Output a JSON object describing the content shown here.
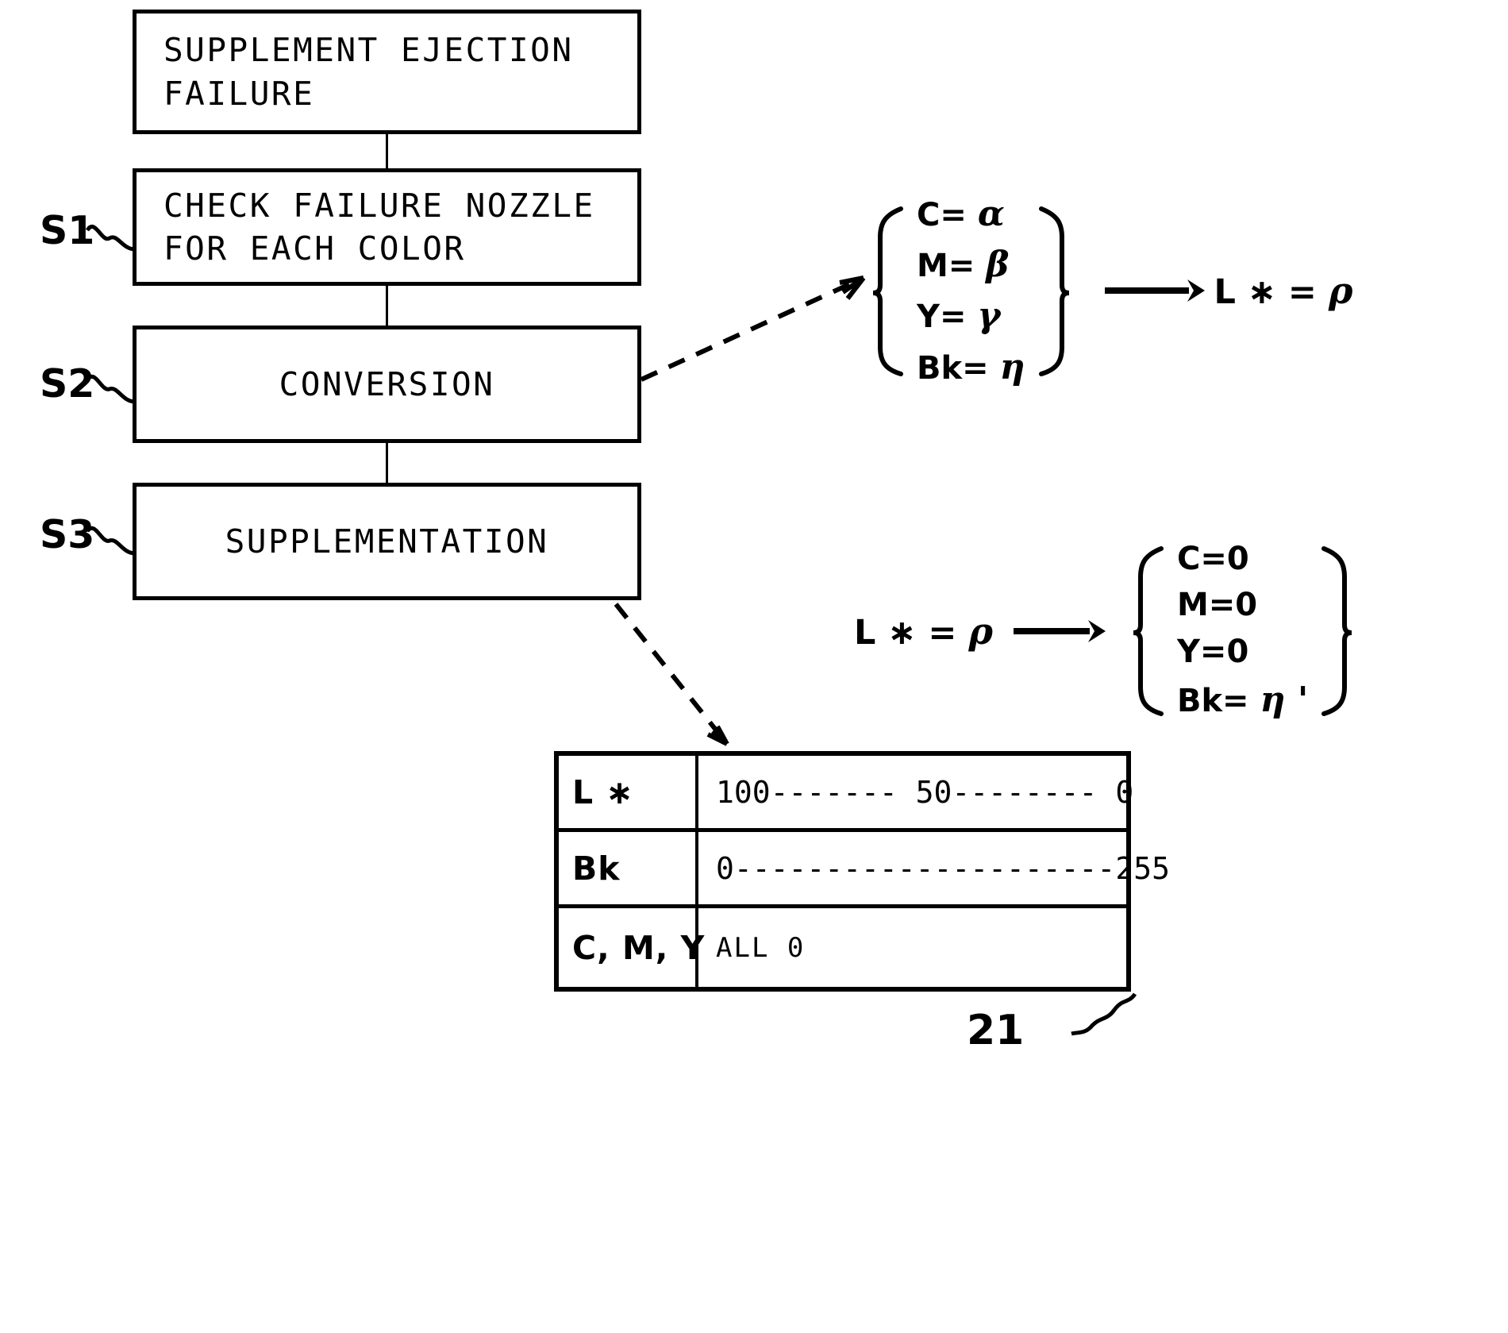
{
  "figure": {
    "reference_number": "21"
  },
  "flow": {
    "boxes": [
      {
        "id": "box-header",
        "text": "SUPPLEMENT EJECTION\nFAILURE",
        "align": "left"
      },
      {
        "id": "box-s1",
        "text": "CHECK FAILURE NOZZLE\nFOR EACH COLOR",
        "align": "left"
      },
      {
        "id": "box-s2",
        "text": "CONVERSION",
        "align": "center"
      },
      {
        "id": "box-s3",
        "text": "SUPPLEMENTATION",
        "align": "center"
      }
    ],
    "step_labels": [
      "S1",
      "S2",
      "S3"
    ]
  },
  "formula_conversion": {
    "rows": [
      {
        "key": "C=",
        "value": "α"
      },
      {
        "key": "M=",
        "value": "β"
      },
      {
        "key": "Y=",
        "value": "γ"
      },
      {
        "key": "Bk=",
        "value": "η"
      }
    ],
    "arrow": "→",
    "result": "L ∗ = ρ",
    "result_prefix": "L ∗ = ",
    "result_symbol": "ρ"
  },
  "formula_supplementation": {
    "source_prefix": "L ∗ = ",
    "source_symbol": "ρ",
    "arrow": "→",
    "rows": [
      {
        "key": "C=",
        "value": "0"
      },
      {
        "key": "M=",
        "value": "0"
      },
      {
        "key": "Y=",
        "value": "0"
      },
      {
        "key": "Bk=",
        "value": "η '"
      }
    ]
  },
  "table": {
    "rows": [
      {
        "key": "L ∗",
        "value": "100------- 50-------- 0",
        "small": false
      },
      {
        "key": "Bk",
        "value": "0---------------------255",
        "small": false
      },
      {
        "key": "C, M, Y",
        "value": "ALL 0",
        "small": true
      }
    ]
  }
}
